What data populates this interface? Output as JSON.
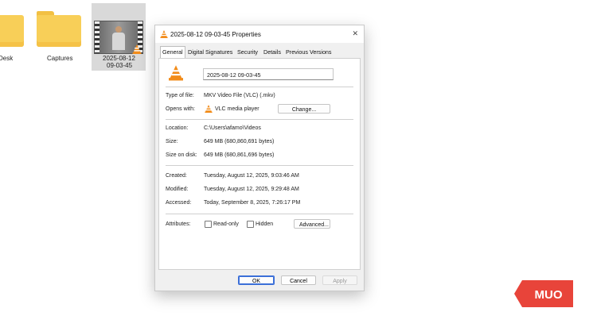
{
  "desktop": {
    "icons": [
      {
        "label": "Desk"
      },
      {
        "label": "Captures"
      },
      {
        "label_line1": "2025-08-12",
        "label_line2": "09-03-45"
      }
    ]
  },
  "dialog": {
    "title": "2025-08-12 09-03-45 Properties",
    "close_glyph": "✕",
    "tabs": [
      "General",
      "Digital Signatures",
      "Security",
      "Details",
      "Previous Versions"
    ],
    "active_tab": "General",
    "file_name": "2025-08-12 09-03-45",
    "type_label": "Type of file:",
    "type_value": "MKV Video File (VLC) (.mkv)",
    "opens_label": "Opens with:",
    "opens_value": "VLC media player",
    "change_button": "Change...",
    "location_label": "Location:",
    "location_value": "C:\\Users\\afamo\\Videos",
    "size_label": "Size:",
    "size_value": "649 MB (680,860,691 bytes)",
    "size_disk_label": "Size on disk:",
    "size_disk_value": "649 MB (680,861,696 bytes)",
    "created_label": "Created:",
    "created_value": "Tuesday, August 12, 2025, 9:03:46 AM",
    "modified_label": "Modified:",
    "modified_value": "Tuesday, August 12, 2025, 9:29:48 AM",
    "accessed_label": "Accessed:",
    "accessed_value": "Today, September 8, 2025, 7:26:17 PM",
    "attributes_label": "Attributes:",
    "readonly_label": "Read-only",
    "hidden_label": "Hidden",
    "advanced_button": "Advanced...",
    "ok_button": "OK",
    "cancel_button": "Cancel",
    "apply_button": "Apply"
  },
  "logo": {
    "text": "MUO",
    "color": "#e8443a"
  }
}
